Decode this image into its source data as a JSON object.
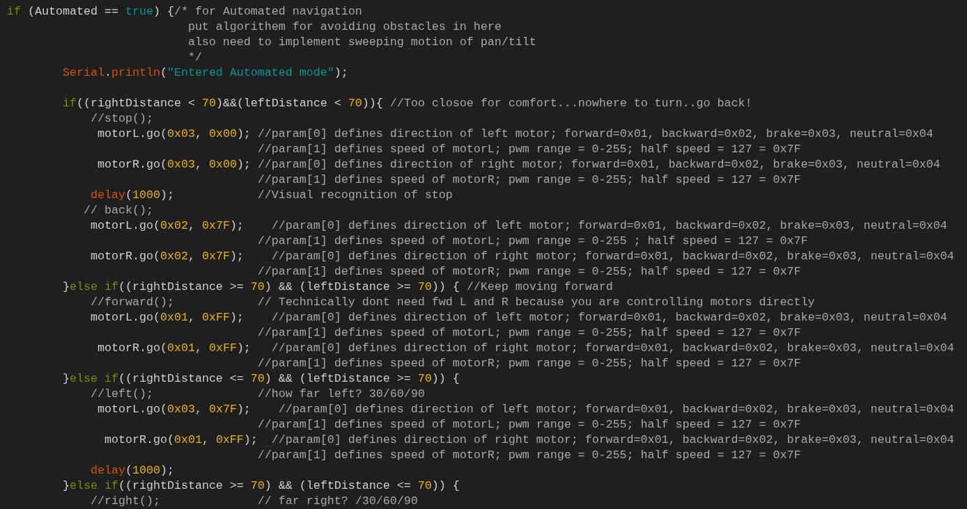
{
  "editor": {
    "lines": [
      {
        "tokens": [
          {
            "kind": "keyword",
            "text": "if"
          },
          {
            "kind": "plain",
            "text": " (Automated == "
          },
          {
            "kind": "constant",
            "text": "true"
          },
          {
            "kind": "plain",
            "text": ") {"
          },
          {
            "kind": "comment",
            "text": "/* for Automated navigation"
          }
        ]
      },
      {
        "tokens": [
          {
            "kind": "comment",
            "text": "                          put algorithem for avoiding obstacles in here"
          }
        ]
      },
      {
        "tokens": [
          {
            "kind": "comment",
            "text": "                          also need to implement sweeping motion of pan/tilt"
          }
        ]
      },
      {
        "tokens": [
          {
            "kind": "comment",
            "text": "                          */"
          }
        ]
      },
      {
        "tokens": [
          {
            "kind": "function",
            "text": "        Serial"
          },
          {
            "kind": "plain",
            "text": "."
          },
          {
            "kind": "function",
            "text": "println"
          },
          {
            "kind": "plain",
            "text": "("
          },
          {
            "kind": "string",
            "text": "\"Entered Automated mode\""
          },
          {
            "kind": "plain",
            "text": ");"
          }
        ]
      },
      {
        "gap_before": true,
        "tokens": [
          {
            "kind": "keyword",
            "text": "        if"
          },
          {
            "kind": "plain",
            "text": "((rightDistance < "
          },
          {
            "kind": "number",
            "text": "70"
          },
          {
            "kind": "plain",
            "text": ")&&(leftDistance < "
          },
          {
            "kind": "number",
            "text": "70"
          },
          {
            "kind": "plain",
            "text": ")){ "
          },
          {
            "kind": "comment",
            "text": "//Too closoe for comfort...nowhere to turn..go back!"
          }
        ]
      },
      {
        "tokens": [
          {
            "kind": "comment",
            "text": "            //stop();"
          }
        ]
      },
      {
        "tokens": [
          {
            "kind": "plain",
            "text": "             motorL.go("
          },
          {
            "kind": "number",
            "text": "0x03"
          },
          {
            "kind": "plain",
            "text": ", "
          },
          {
            "kind": "number",
            "text": "0x00"
          },
          {
            "kind": "plain",
            "text": "); "
          },
          {
            "kind": "comment",
            "text": "//param[0] defines direction of left motor; forward=0x01, backward=0x02, brake=0x03, neutral=0x04"
          }
        ]
      },
      {
        "tokens": [
          {
            "kind": "comment",
            "text": "                                    //param[1] defines speed of motorL; pwm range = 0-255; half speed = 127 = 0x7F"
          }
        ]
      },
      {
        "tokens": [
          {
            "kind": "plain",
            "text": "             motorR.go("
          },
          {
            "kind": "number",
            "text": "0x03"
          },
          {
            "kind": "plain",
            "text": ", "
          },
          {
            "kind": "number",
            "text": "0x00"
          },
          {
            "kind": "plain",
            "text": "); "
          },
          {
            "kind": "comment",
            "text": "//param[0] defines direction of right motor; forward=0x01, backward=0x02, brake=0x03, neutral=0x04"
          }
        ]
      },
      {
        "tokens": [
          {
            "kind": "comment",
            "text": "                                    //param[1] defines speed of motorR; pwm range = 0-255; half speed = 127 = 0x7F"
          }
        ]
      },
      {
        "tokens": [
          {
            "kind": "function",
            "text": "            delay"
          },
          {
            "kind": "plain",
            "text": "("
          },
          {
            "kind": "number",
            "text": "1000"
          },
          {
            "kind": "plain",
            "text": ");            "
          },
          {
            "kind": "comment",
            "text": "//Visual recognition of stop"
          }
        ]
      },
      {
        "tokens": [
          {
            "kind": "comment",
            "text": "           // back();"
          }
        ]
      },
      {
        "tokens": [
          {
            "kind": "plain",
            "text": "            motorL.go("
          },
          {
            "kind": "number",
            "text": "0x02"
          },
          {
            "kind": "plain",
            "text": ", "
          },
          {
            "kind": "number",
            "text": "0x7F"
          },
          {
            "kind": "plain",
            "text": ");    "
          },
          {
            "kind": "comment",
            "text": "//param[0] defines direction of left motor; forward=0x01, backward=0x02, brake=0x03, neutral=0x04"
          }
        ]
      },
      {
        "tokens": [
          {
            "kind": "comment",
            "text": "                                    //param[1] defines speed of motorL; pwm range = 0-255 ; half speed = 127 = 0x7F"
          }
        ]
      },
      {
        "tokens": [
          {
            "kind": "plain",
            "text": "            motorR.go("
          },
          {
            "kind": "number",
            "text": "0x02"
          },
          {
            "kind": "plain",
            "text": ", "
          },
          {
            "kind": "number",
            "text": "0x7F"
          },
          {
            "kind": "plain",
            "text": ");    "
          },
          {
            "kind": "comment",
            "text": "//param[0] defines direction of right motor; forward=0x01, backward=0x02, brake=0x03, neutral=0x04"
          }
        ]
      },
      {
        "tokens": [
          {
            "kind": "comment",
            "text": "                                    //param[1] defines speed of motorR; pwm range = 0-255; half speed = 127 = 0x7F"
          }
        ]
      },
      {
        "tokens": [
          {
            "kind": "plain",
            "text": "        }"
          },
          {
            "kind": "keyword",
            "text": "else if"
          },
          {
            "kind": "plain",
            "text": "((rightDistance >= "
          },
          {
            "kind": "number",
            "text": "70"
          },
          {
            "kind": "plain",
            "text": ") && (leftDistance >= "
          },
          {
            "kind": "number",
            "text": "70"
          },
          {
            "kind": "plain",
            "text": ")) { "
          },
          {
            "kind": "comment",
            "text": "//Keep moving forward"
          }
        ]
      },
      {
        "tokens": [
          {
            "kind": "comment",
            "text": "            //forward();            // Technically dont need fwd L and R because you are controlling motors directly"
          }
        ]
      },
      {
        "tokens": [
          {
            "kind": "plain",
            "text": "            motorL.go("
          },
          {
            "kind": "number",
            "text": "0x01"
          },
          {
            "kind": "plain",
            "text": ", "
          },
          {
            "kind": "number",
            "text": "0xFF"
          },
          {
            "kind": "plain",
            "text": ");    "
          },
          {
            "kind": "comment",
            "text": "//param[0] defines direction of left motor; forward=0x01, backward=0x02, brake=0x03, neutral=0x04"
          }
        ]
      },
      {
        "tokens": [
          {
            "kind": "comment",
            "text": "                                    //param[1] defines speed of motorL; pwm range = 0-255; half speed = 127 = 0x7F"
          }
        ]
      },
      {
        "tokens": [
          {
            "kind": "plain",
            "text": "             motorR.go("
          },
          {
            "kind": "number",
            "text": "0x01"
          },
          {
            "kind": "plain",
            "text": ", "
          },
          {
            "kind": "number",
            "text": "0xFF"
          },
          {
            "kind": "plain",
            "text": ");   "
          },
          {
            "kind": "comment",
            "text": "//param[0] defines direction of right motor; forward=0x01, backward=0x02, brake=0x03, neutral=0x04"
          }
        ]
      },
      {
        "tokens": [
          {
            "kind": "comment",
            "text": "                                    //param[1] defines speed of motorR; pwm range = 0-255; half speed = 127 = 0x7F"
          }
        ]
      },
      {
        "tokens": [
          {
            "kind": "plain",
            "text": "        }"
          },
          {
            "kind": "keyword",
            "text": "else if"
          },
          {
            "kind": "plain",
            "text": "((rightDistance <= "
          },
          {
            "kind": "number",
            "text": "70"
          },
          {
            "kind": "plain",
            "text": ") && (leftDistance >= "
          },
          {
            "kind": "number",
            "text": "70"
          },
          {
            "kind": "plain",
            "text": ")) {"
          }
        ]
      },
      {
        "tokens": [
          {
            "kind": "comment",
            "text": "            //left();               //how far left? 30/60/90"
          }
        ]
      },
      {
        "tokens": [
          {
            "kind": "plain",
            "text": "             motorL.go("
          },
          {
            "kind": "number",
            "text": "0x03"
          },
          {
            "kind": "plain",
            "text": ", "
          },
          {
            "kind": "number",
            "text": "0x7F"
          },
          {
            "kind": "plain",
            "text": ");    "
          },
          {
            "kind": "comment",
            "text": "//param[0] defines direction of left motor; forward=0x01, backward=0x02, brake=0x03, neutral=0x04"
          }
        ]
      },
      {
        "tokens": [
          {
            "kind": "comment",
            "text": "                                    //param[1] defines speed of motorL; pwm range = 0-255; half speed = 127 = 0x7F"
          }
        ]
      },
      {
        "tokens": [
          {
            "kind": "plain",
            "text": "              motorR.go("
          },
          {
            "kind": "number",
            "text": "0x01"
          },
          {
            "kind": "plain",
            "text": ", "
          },
          {
            "kind": "number",
            "text": "0xFF"
          },
          {
            "kind": "plain",
            "text": ");  "
          },
          {
            "kind": "comment",
            "text": "//param[0] defines direction of right motor; forward=0x01, backward=0x02, brake=0x03, neutral=0x04"
          }
        ]
      },
      {
        "tokens": [
          {
            "kind": "comment",
            "text": "                                    //param[1] defines speed of motorR; pwm range = 0-255; half speed = 127 = 0x7F"
          }
        ]
      },
      {
        "tokens": [
          {
            "kind": "function",
            "text": "            delay"
          },
          {
            "kind": "plain",
            "text": "("
          },
          {
            "kind": "number",
            "text": "1000"
          },
          {
            "kind": "plain",
            "text": ");"
          }
        ]
      },
      {
        "tokens": [
          {
            "kind": "plain",
            "text": "        }"
          },
          {
            "kind": "keyword",
            "text": "else if"
          },
          {
            "kind": "plain",
            "text": "((rightDistance >= "
          },
          {
            "kind": "number",
            "text": "70"
          },
          {
            "kind": "plain",
            "text": ") && (leftDistance <= "
          },
          {
            "kind": "number",
            "text": "70"
          },
          {
            "kind": "plain",
            "text": ")) {"
          }
        ]
      },
      {
        "tokens": [
          {
            "kind": "comment",
            "text": "            //right();              // far right? /30/60/90"
          }
        ]
      }
    ]
  }
}
